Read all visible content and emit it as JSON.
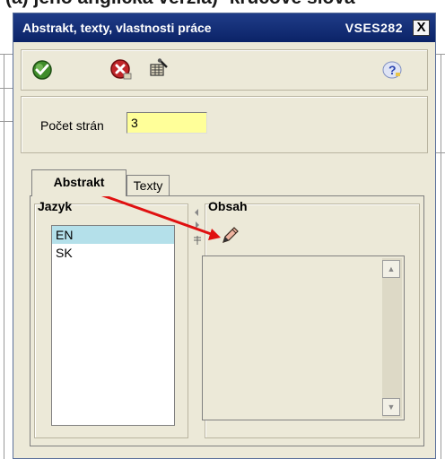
{
  "caption": "(a) jeho anglická verzia) -kľúčové slová",
  "window": {
    "title": "Abstrakt, texty, vlastnosti práce",
    "code": "VSES282",
    "close_label": "X"
  },
  "toolbar": {
    "confirm_icon": "green-check-icon",
    "cancel_icon": "red-cancel-icon",
    "tool_icon": "tool-icon",
    "help_icon": "help-icon"
  },
  "pages": {
    "label": "Počet strán",
    "value": "3"
  },
  "tabs": [
    {
      "label": "Abstrakt",
      "active": true
    },
    {
      "label": "Texty",
      "active": false
    }
  ],
  "languages": {
    "title": "Jazyk",
    "items": [
      {
        "label": "EN",
        "selected": true
      },
      {
        "label": "SK",
        "selected": false
      }
    ]
  },
  "content": {
    "title": "Obsah",
    "edit_icon": "pencil-icon"
  },
  "colors": {
    "titlebar": "#0b2367",
    "input_highlight": "#ffff99",
    "selected_row": "#b4e0ea",
    "annotation_arrow": "#e01010"
  }
}
